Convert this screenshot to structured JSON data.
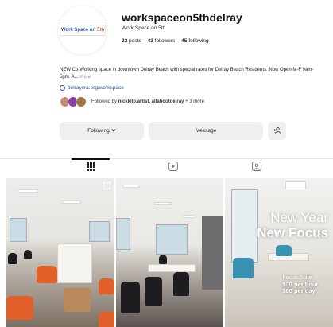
{
  "profile": {
    "username": "workspaceon5thdelray",
    "more_icon": "···",
    "full_name": "Work Space on 5th",
    "logo_text_main": "Work Space on",
    "logo_text_accent": "5th",
    "stats": {
      "posts_count": "22",
      "posts_label": "posts",
      "followers_count": "43",
      "followers_label": "followers",
      "following_count": "45",
      "following_label": "following"
    },
    "bio": "NEW Co-Working space in downtown Delray Beach with special rates for Delray Beach Residents. Now Open M-F 9am-5pm. A...",
    "bio_more": "more",
    "link": "delraycra.org/workspace",
    "followed_by_prefix": "Followed by",
    "followed_by_names": "nickkilp.artist, allaboutdelray",
    "followed_by_suffix": "+ 3 more"
  },
  "actions": {
    "following_label": "Following",
    "message_label": "Message",
    "add_user_icon": "+👤"
  },
  "tabs": [
    {
      "name": "posts",
      "icon": "grid-icon",
      "active": true
    },
    {
      "name": "reels",
      "icon": "reels-icon",
      "active": false
    },
    {
      "name": "tagged",
      "icon": "tagged-icon",
      "active": false
    }
  ],
  "posts": [
    {
      "type": "carousel",
      "caption": ""
    },
    {
      "type": "image",
      "caption": ""
    },
    {
      "type": "image",
      "headline_line1": "New Year",
      "headline_line2": "New Focus",
      "subtitle": "Focus Suite",
      "price1": "$20 per hour",
      "price2": "$60 per day"
    }
  ],
  "colors": {
    "link": "#2b4f8f",
    "button_bg": "#efefef",
    "accent_orange": "#e05a26",
    "logo_blue": "#2c5aa8"
  }
}
